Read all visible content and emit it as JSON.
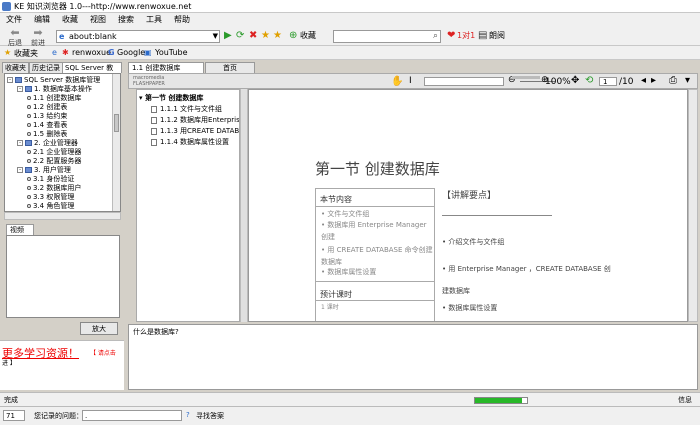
{
  "window": {
    "title": "KE 知识浏览器 1.0---http://www.renwoxue.net"
  },
  "menu": [
    "文件",
    "编辑",
    "收藏",
    "视图",
    "搜索",
    "工具",
    "帮助"
  ],
  "toolbar": {
    "back_label": "后退",
    "forward_label": "前进",
    "address_value": "about:blank",
    "favorite_label": "收藏",
    "pair_label": "1对1",
    "tts_label": "朗阅"
  },
  "favbar": {
    "favorites": "收藏夹",
    "items": [
      "renwoxue",
      "Google",
      "YouTube"
    ]
  },
  "left_tabs": [
    "收藏夹",
    "历史记录",
    "SQL Server 教"
  ],
  "tree": [
    {
      "level": 0,
      "kind": "book",
      "label": "SQL Server 数据库管理"
    },
    {
      "level": 1,
      "kind": "book",
      "label": "1. 数据库基本操作"
    },
    {
      "level": 2,
      "kind": "dot",
      "label": "1.1 创建数据库"
    },
    {
      "level": 2,
      "kind": "dot",
      "label": "1.2 创建表"
    },
    {
      "level": 2,
      "kind": "dot",
      "label": "1.3 给约束"
    },
    {
      "level": 2,
      "kind": "dot",
      "label": "1.4 查看表"
    },
    {
      "level": 2,
      "kind": "dot",
      "label": "1.5 删除表"
    },
    {
      "level": 1,
      "kind": "book",
      "label": "2. 企业管理器"
    },
    {
      "level": 2,
      "kind": "dot",
      "label": "2.1 企业管理器"
    },
    {
      "level": 2,
      "kind": "dot",
      "label": "2.2 配置服务器"
    },
    {
      "level": 1,
      "kind": "book",
      "label": "3. 用户管理"
    },
    {
      "level": 2,
      "kind": "dot",
      "label": "3.1 身份验证"
    },
    {
      "level": 2,
      "kind": "dot",
      "label": "3.2 数据库用户"
    },
    {
      "level": 2,
      "kind": "dot",
      "label": "3.3 权限管理"
    },
    {
      "level": 2,
      "kind": "dot",
      "label": "3.4 角色管理"
    }
  ],
  "video": {
    "tab": "视频",
    "zoom_button": "放大"
  },
  "promo": {
    "big": "更多学习资源！",
    "link": "【 请点击",
    "link2": "进 】"
  },
  "middle_tabs": [
    "1.1 创建数据库",
    "首页"
  ],
  "flash": {
    "brand": "macromedia FLASHPAPER",
    "zoom": "100%",
    "page": "1",
    "total": "/10"
  },
  "toc": {
    "root": "第一节 创建数据库",
    "items": [
      "1.1.1 文件与文件组",
      "1.1.2 数据库用Enterprise",
      "1.1.3 用CREATE DATABA",
      "1.1.4 数据库属性设置"
    ]
  },
  "doc": {
    "title": "第一节  创建数据库",
    "content_heading": "本节内容",
    "content_items": [
      "文件与文件组",
      "数据库用 Enterprise Manager 创建",
      "用 CREATE DATABASE 命令创建数据库",
      "数据库属性设置"
    ],
    "time_heading": "预计课时",
    "time_value": "1 课时",
    "key_heading": "【讲解要点】",
    "key_items": [
      "介绍文件与文件组",
      "用 Enterprise Manager ，CREATE DATABASE 创建数据库",
      "数据库属性设置"
    ]
  },
  "question": {
    "prompt": "什么是数据库?"
  },
  "status": {
    "left": "完成",
    "right": "信息",
    "progress": 0.9
  },
  "bottom": {
    "count": "71",
    "label": "您记录的问题：",
    "value": ".",
    "find": "寻找答案"
  },
  "colors": {
    "promo_red": "#e00000",
    "progress_green": "#28b828",
    "tree_book": "#6a8cd0"
  }
}
